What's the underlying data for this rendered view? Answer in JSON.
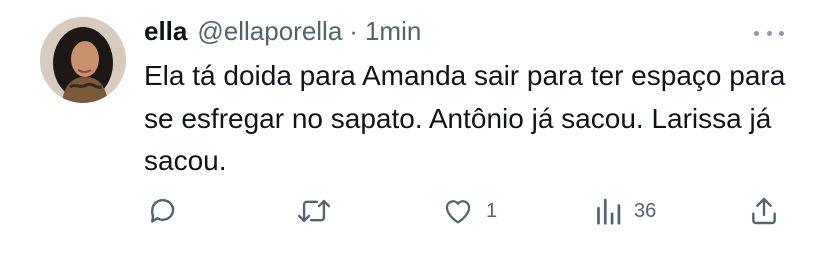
{
  "tweet": {
    "author": {
      "name": "ella",
      "handle": "@ellaporella",
      "separator": "·",
      "time": "1min"
    },
    "text": "Ela tá doida para Amanda sair para ter espaço para se esfregar no sapato. Antônio já sacou. Larissa já sacou.",
    "actions": {
      "likes": "1",
      "views": "36"
    }
  },
  "icons": {
    "more": "more-horizontal-icon",
    "reply": "reply-icon",
    "retweet": "retweet-icon",
    "like": "heart-icon",
    "views": "views-bar-icon",
    "share": "share-icon"
  },
  "colors": {
    "text": "#0f1419",
    "secondary": "#536471"
  }
}
